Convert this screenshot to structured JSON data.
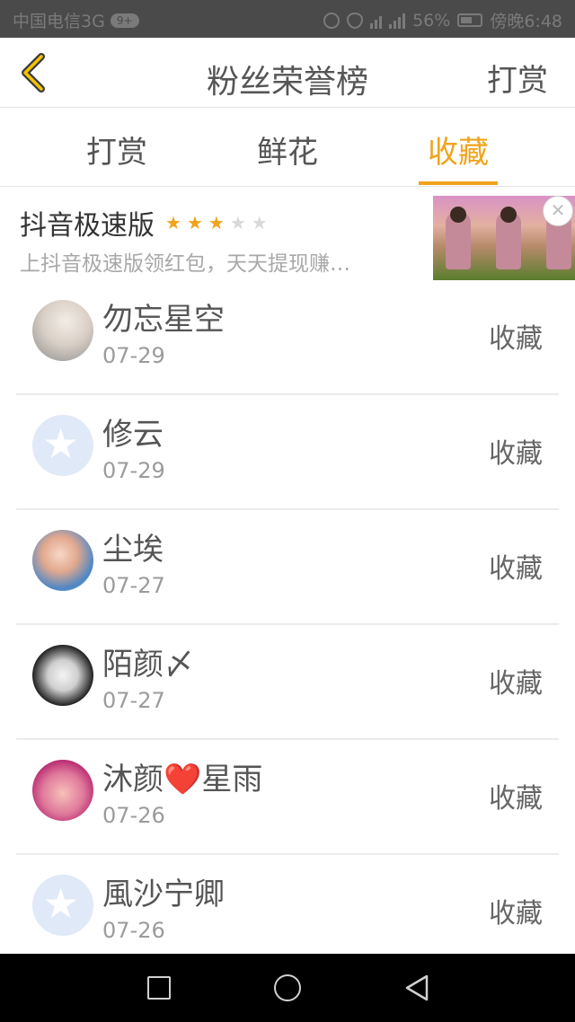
{
  "status_bar": {
    "carrier": "中国电信3G",
    "msg_count": "9+",
    "battery": "56%",
    "time": "傍晚6:48"
  },
  "header": {
    "title": "粉丝荣誉榜",
    "action": "打赏",
    "back_icon": "chevron-left-icon"
  },
  "tabs": [
    {
      "label": "打赏",
      "active": false
    },
    {
      "label": "鲜花",
      "active": false
    },
    {
      "label": "收藏",
      "active": true
    }
  ],
  "ad": {
    "title": "抖音极速版",
    "rating_stars": 3,
    "rating_max": 5,
    "description": "上抖音极速版领红包，天天提现赚…",
    "close_icon": "close-icon"
  },
  "list": [
    {
      "name": "勿忘星空",
      "date": "07-29",
      "action": "收藏",
      "avatar": "photo"
    },
    {
      "name": "修云",
      "date": "07-29",
      "action": "收藏",
      "avatar": "qq-default"
    },
    {
      "name": "尘埃",
      "date": "07-27",
      "action": "收藏",
      "avatar": "photo"
    },
    {
      "name": "陌颜〆",
      "date": "07-27",
      "action": "收藏",
      "avatar": "photo"
    },
    {
      "name": "沐颜❤️星雨",
      "date": "07-26",
      "action": "收藏",
      "avatar": "photo"
    },
    {
      "name": "風沙宁卿",
      "date": "07-26",
      "action": "收藏",
      "avatar": "qq-default"
    }
  ],
  "colors": {
    "accent": "#f0a31c",
    "status_bar_bg": "#4a4a4a",
    "nav_bar_bg": "#000000"
  }
}
